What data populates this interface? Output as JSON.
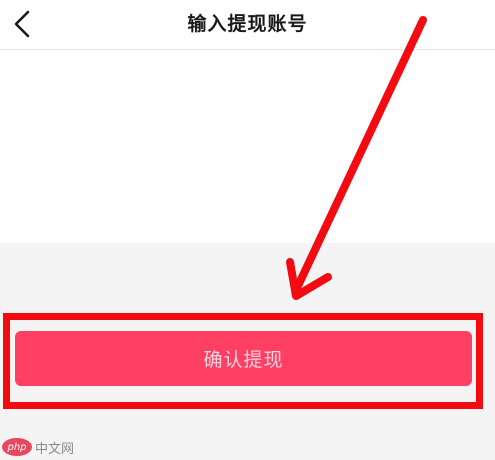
{
  "header": {
    "back_icon": "chevron-left-icon",
    "title": "输入提现账号"
  },
  "main": {
    "confirm_button_label": "确认提现"
  },
  "annotation": {
    "color": "#f20c12"
  },
  "watermark": {
    "logo_text": "php",
    "text": "中文网"
  },
  "colors": {
    "button_bg": "#ff3f63",
    "button_text": "#ffd5dd",
    "gray_bg": "#f4f4f4"
  }
}
